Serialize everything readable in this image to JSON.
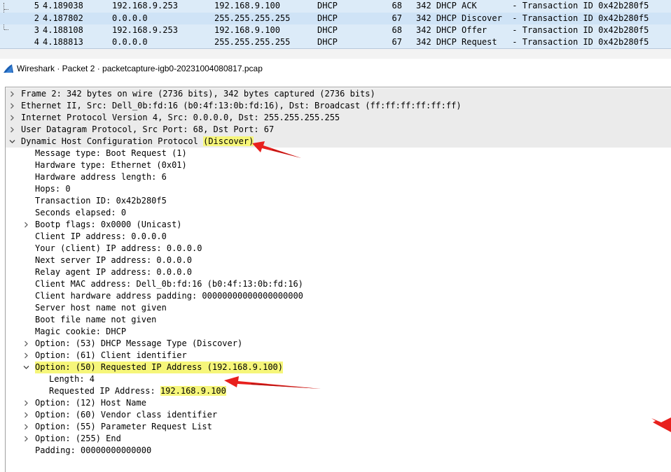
{
  "packet_list": {
    "rows": [
      {
        "no": "2",
        "time": "4.187802",
        "src": "0.0.0.0",
        "dst": "255.255.255.255",
        "proto": "DHCP",
        "len": "67",
        "info": "342 DHCP Discover  - Transaction ID 0x42b280f5",
        "selected": true
      },
      {
        "no": "3",
        "time": "4.188108",
        "src": "192.168.9.253",
        "dst": "192.168.9.100",
        "proto": "DHCP",
        "len": "68",
        "info": "342 DHCP Offer     - Transaction ID 0x42b280f5",
        "selected": false
      },
      {
        "no": "4",
        "time": "4.188813",
        "src": "0.0.0.0",
        "dst": "255.255.255.255",
        "proto": "DHCP",
        "len": "67",
        "info": "342 DHCP Request   - Transaction ID 0x42b280f5",
        "selected": false
      },
      {
        "no": "5",
        "time": "4.189038",
        "src": "192.168.9.253",
        "dst": "192.168.9.100",
        "proto": "DHCP",
        "len": "68",
        "info": "342 DHCP ACK       - Transaction ID 0x42b280f5",
        "selected": false
      }
    ]
  },
  "window": {
    "title": "Wireshark · Packet 2 · packetcapture-igb0-20231004080817.pcap",
    "icon": "wireshark-fin-icon",
    "accent": "#1a5fb4"
  },
  "details": {
    "frame": "Frame 2: 342 bytes on wire (2736 bits), 342 bytes captured (2736 bits)",
    "ethernet": "Ethernet II, Src: Dell_0b:fd:16 (b0:4f:13:0b:fd:16), Dst: Broadcast (ff:ff:ff:ff:ff:ff)",
    "ip": "Internet Protocol Version 4, Src: 0.0.0.0, Dst: 255.255.255.255",
    "udp": "User Datagram Protocol, Src Port: 68, Dst Port: 67",
    "dhcp_prefix": "Dynamic Host Configuration Protocol ",
    "dhcp_highlight": "(Discover)",
    "message_type": "Message type: Boot Request (1)",
    "hardware_type": "Hardware type: Ethernet (0x01)",
    "hw_addr_len": "Hardware address length: 6",
    "hops": "Hops: 0",
    "transaction_id": "Transaction ID: 0x42b280f5",
    "seconds": "Seconds elapsed: 0",
    "bootp_flags": "Bootp flags: 0x0000 (Unicast)",
    "client_ip": "Client IP address: 0.0.0.0",
    "your_ip": "Your (client) IP address: 0.0.0.0",
    "next_server": "Next server IP address: 0.0.0.0",
    "relay_agent": "Relay agent IP address: 0.0.0.0",
    "client_mac": "Client MAC address: Dell_0b:fd:16 (b0:4f:13:0b:fd:16)",
    "hw_padding": "Client hardware address padding: 00000000000000000000",
    "server_host": "Server host name not given",
    "boot_file": "Boot file name not given",
    "magic_cookie": "Magic cookie: DHCP",
    "opt53": "Option: (53) DHCP Message Type (Discover)",
    "opt61": "Option: (61) Client identifier",
    "opt50": "Option: (50) Requested IP Address (192.168.9.100)",
    "opt50_length": "Length: 4",
    "opt50_req_prefix": "Requested IP Address: ",
    "opt50_req_value": "192.168.9.100",
    "opt12": "Option: (12) Host Name",
    "opt60": "Option: (60) Vendor class identifier",
    "opt55": "Option: (55) Parameter Request List",
    "opt255": "Option: (255) End",
    "padding": "Padding: 00000000000000"
  },
  "colors": {
    "highlight": "#f6f67a",
    "annotation_red": "#e8201d",
    "packet_list_bg": "#dcebf8"
  }
}
